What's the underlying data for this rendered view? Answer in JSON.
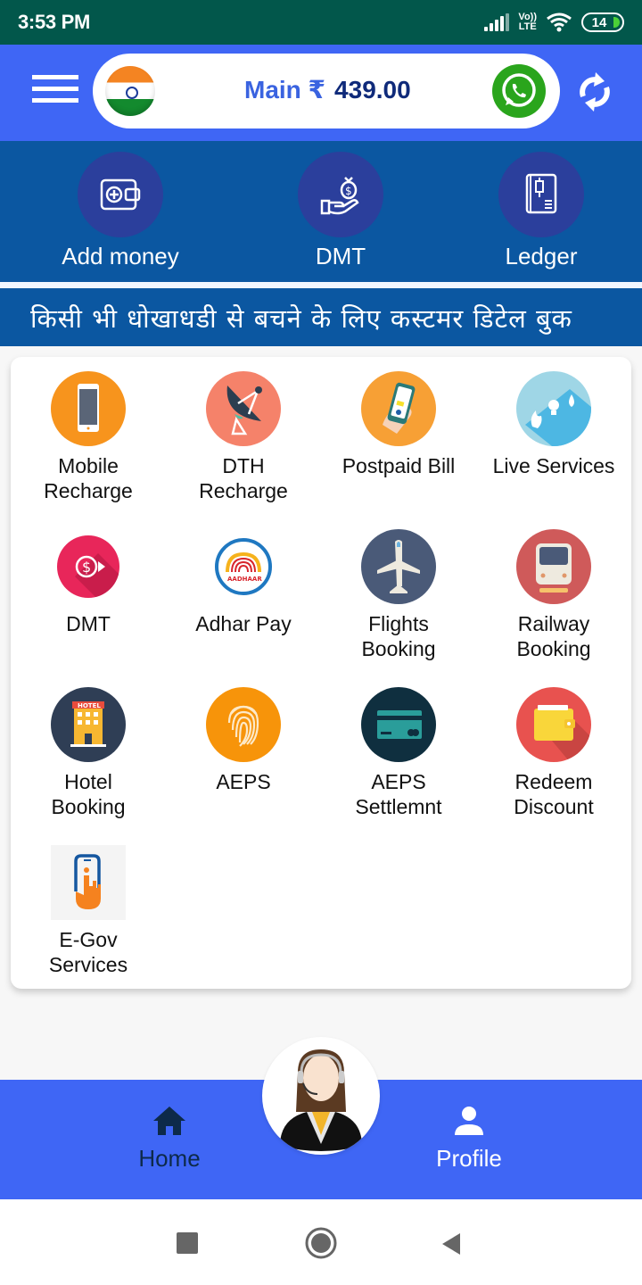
{
  "status_bar": {
    "time": "3:53 PM",
    "network": "VoLTE",
    "volte_top": "Vo))",
    "volte_bottom": "LTE",
    "battery": "14"
  },
  "header": {
    "menu_icon": "hamburger-menu-icon",
    "flag_icon": "india-flag-icon",
    "balance_label": "Main ₹",
    "balance_amount": "439.00",
    "whatsapp_icon": "whatsapp-icon",
    "refresh_icon": "refresh-icon"
  },
  "quick_actions": [
    {
      "label": "Add money",
      "icon": "wallet-plus-icon"
    },
    {
      "label": "DMT",
      "icon": "money-hand-icon"
    },
    {
      "label": "Ledger",
      "icon": "ledger-book-icon"
    }
  ],
  "marquee": {
    "text": "किसी भी धोखाधडी से बचने के लिए कस्टमर डिटेल बुक"
  },
  "services": [
    {
      "label_line1": "Mobile",
      "label_line2": "Recharge",
      "icon": "mobile-phone-icon",
      "color": "#f7941d"
    },
    {
      "label_line1": "DTH",
      "label_line2": "Recharge",
      "icon": "satellite-dish-icon",
      "color": "#f5826a"
    },
    {
      "label_line1": "Postpaid Bill",
      "label_line2": "",
      "icon": "phone-in-hand-icon",
      "color": "#f7a035"
    },
    {
      "label_line1": "Live Services",
      "label_line2": "",
      "icon": "utilities-icon",
      "color": "#9fd6e6"
    },
    {
      "label_line1": "DMT",
      "label_line2": "",
      "icon": "dollar-transfer-icon",
      "color": "#e8265a"
    },
    {
      "label_line1": "Adhar Pay",
      "label_line2": "",
      "icon": "aadhaar-icon",
      "color": "#1f78c1"
    },
    {
      "label_line1": "Flights",
      "label_line2": "Booking",
      "icon": "airplane-icon",
      "color": "#4a5a78"
    },
    {
      "label_line1": "Railway",
      "label_line2": "Booking",
      "icon": "train-icon",
      "color": "#cf5a5a"
    },
    {
      "label_line1": "Hotel",
      "label_line2": "Booking",
      "icon": "hotel-icon",
      "color": "#2f3e55"
    },
    {
      "label_line1": "AEPS",
      "label_line2": "",
      "icon": "fingerprint-icon",
      "color": "#f7940a"
    },
    {
      "label_line1": "AEPS",
      "label_line2": "Settlemnt",
      "icon": "card-icon",
      "color": "#0f2f3f"
    },
    {
      "label_line1": "Redeem",
      "label_line2": "Discount",
      "icon": "wallet-icon",
      "color": "#e8524f"
    },
    {
      "label_line1": "E-Gov",
      "label_line2": "Services",
      "icon": "touch-phone-icon",
      "color": "#f4f4f4"
    }
  ],
  "bottom_nav": {
    "home_label": "Home",
    "profile_label": "Profile",
    "support_icon": "customer-support-avatar"
  },
  "colors": {
    "status_bar": "#02574b",
    "header": "#3f66f5",
    "quick_band": "#0b57a1",
    "quick_circle": "#2b3f9c",
    "balance_amount": "#0f2a7a",
    "home_active": "#0d2a4a"
  }
}
